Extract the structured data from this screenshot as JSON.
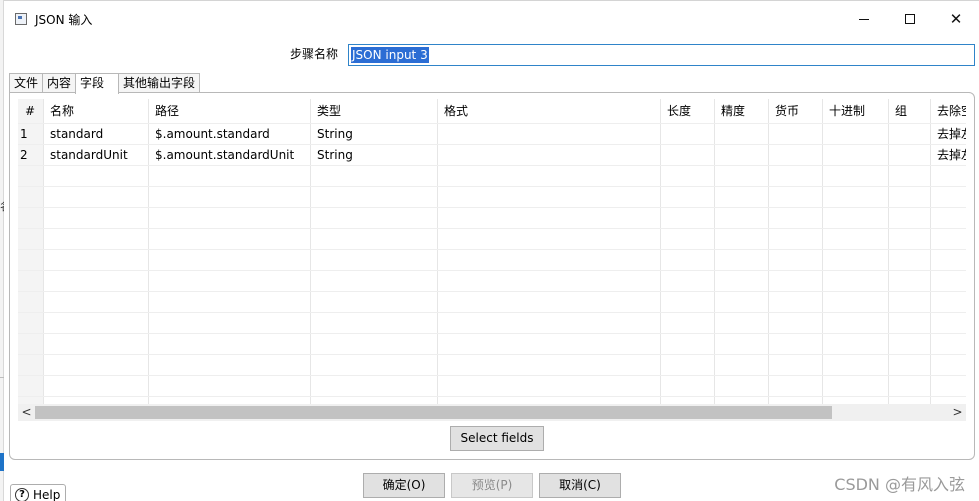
{
  "window": {
    "title": "JSON 输入",
    "controls": {
      "minimize": "—",
      "maximize": "□",
      "close": "✕"
    }
  },
  "step": {
    "label": "步骤名称",
    "value": "JSON input 3"
  },
  "tabs": [
    {
      "label": "文件"
    },
    {
      "label": "内容"
    },
    {
      "label": "字段",
      "active": true
    },
    {
      "label": "其他输出字段"
    }
  ],
  "table": {
    "headers": [
      "#",
      "名称",
      "路径",
      "类型",
      "格式",
      "长度",
      "精度",
      "货币",
      "十进制",
      "组",
      "去除空"
    ],
    "rows": [
      {
        "num": "1",
        "name": "standard",
        "path": "$.amount.standard",
        "type": "String",
        "trim": "去掉左"
      },
      {
        "num": "2",
        "name": "standardUnit",
        "path": "$.amount.standardUnit",
        "type": "String",
        "trim": "去掉左"
      }
    ]
  },
  "scrollbar": {
    "left_arrow": "<",
    "right_arrow": ">"
  },
  "select_fields_label": "Select fields",
  "buttons": {
    "ok": "确定(O)",
    "preview": "预览(P)",
    "cancel": "取消(C)"
  },
  "help_label": "Help",
  "watermark": "CSDN @有风入弦",
  "left_edge_mark": "名"
}
